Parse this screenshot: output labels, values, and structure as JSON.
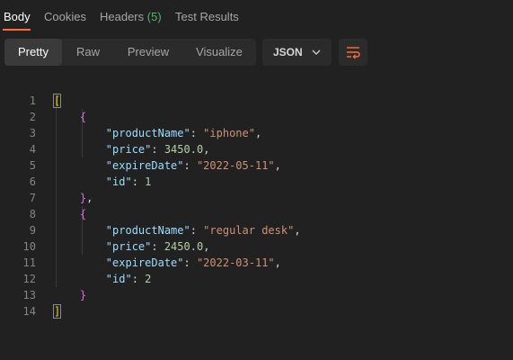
{
  "tabs": [
    {
      "label": "Body",
      "active": true
    },
    {
      "label": "Cookies",
      "active": false
    },
    {
      "label": "Headers",
      "count": "(5)",
      "active": false
    },
    {
      "label": "Test Results",
      "active": false
    }
  ],
  "view_modes": [
    {
      "label": "Pretty",
      "active": true
    },
    {
      "label": "Raw",
      "active": false
    },
    {
      "label": "Preview",
      "active": false
    },
    {
      "label": "Visualize",
      "active": false
    }
  ],
  "format": {
    "selected": "JSON"
  },
  "wrap_icon": "wrap-lines-icon",
  "colors": {
    "accent": "#ff6c37",
    "count": "#57b36b",
    "key": "#9cdcfe",
    "string": "#ce9178",
    "number": "#b5cea8"
  },
  "editor": {
    "line_numbers": [
      "1",
      "2",
      "3",
      "4",
      "5",
      "6",
      "7",
      "8",
      "9",
      "10",
      "11",
      "12",
      "13",
      "14"
    ],
    "records": [
      {
        "productName_key": "\"productName\"",
        "productName": "\"iphone\"",
        "price_key": "\"price\"",
        "price": "3450.0",
        "expireDate_key": "\"expireDate\"",
        "expireDate": "\"2022-05-11\"",
        "id_key": "\"id\"",
        "id": "1"
      },
      {
        "productName_key": "\"productName\"",
        "productName": "\"regular desk\"",
        "price_key": "\"price\"",
        "price": "2450.0",
        "expireDate_key": "\"expireDate\"",
        "expireDate": "\"2022-03-11\"",
        "id_key": "\"id\"",
        "id": "2"
      }
    ]
  }
}
